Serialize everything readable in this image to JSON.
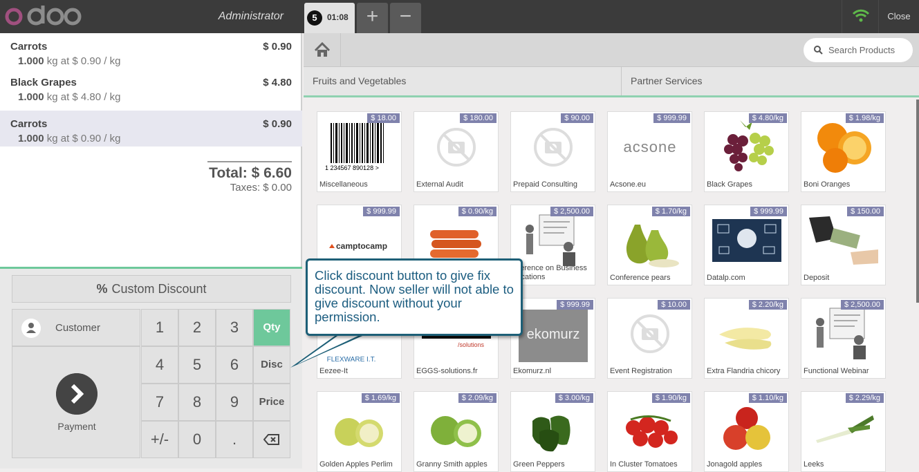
{
  "header": {
    "brand": "odoo",
    "user": "Administrator",
    "order_number": "5",
    "order_time": "01:08",
    "add_order_label": "+",
    "remove_order_label": "−",
    "close_label": "Close"
  },
  "order": {
    "lines": [
      {
        "name": "Carrots",
        "price": "$ 0.90",
        "qty": "1.000",
        "info": "kg at $ 0.90 / kg"
      },
      {
        "name": "Black Grapes",
        "price": "$ 4.80",
        "qty": "1.000",
        "info": "kg at $ 4.80 / kg"
      },
      {
        "name": "Carrots",
        "price": "$ 0.90",
        "qty": "1.000",
        "info": "kg at $ 0.90 / kg"
      }
    ],
    "total": "Total: $ 6.60",
    "taxes": "Taxes: $ 0.00"
  },
  "pad": {
    "custom_discount": "Custom Discount",
    "customer": "Customer",
    "payment": "Payment",
    "keys": [
      "1",
      "2",
      "3",
      "4",
      "5",
      "6",
      "7",
      "8",
      "9",
      "+/-",
      "0",
      "."
    ],
    "qty": "Qty",
    "disc": "Disc",
    "price": "Price"
  },
  "products_header": {
    "search_placeholder": "Search Products",
    "categories": [
      "Fruits and Vegetables",
      "Partner Services"
    ]
  },
  "products": [
    {
      "name": "Miscellaneous",
      "price": "$ 18.00"
    },
    {
      "name": "External Audit",
      "price": "$ 180.00"
    },
    {
      "name": "Prepaid Consulting",
      "price": "$ 90.00"
    },
    {
      "name": "Acsone.eu",
      "price": "$ 999.99"
    },
    {
      "name": "Black Grapes",
      "price": "$ 4.80/kg"
    },
    {
      "name": "Boni Oranges",
      "price": "$ 1.98/kg"
    },
    {
      "name": "",
      "price": "$ 999.99"
    },
    {
      "name": "",
      "price": "$ 0.90/kg"
    },
    {
      "name": "Conference on Business Applications",
      "price": "$ 2,500.00"
    },
    {
      "name": "Conference pears",
      "price": "$ 1.70/kg"
    },
    {
      "name": "Datalp.com",
      "price": "$ 999.99"
    },
    {
      "name": "Deposit",
      "price": "$ 150.00"
    },
    {
      "name": "Eezee-It",
      "price": ""
    },
    {
      "name": "EGGS-solutions.fr",
      "price": ""
    },
    {
      "name": "Ekomurz.nl",
      "price": "$ 999.99"
    },
    {
      "name": "Event Registration",
      "price": "$ 10.00"
    },
    {
      "name": "Extra Flandria chicory",
      "price": "$ 2.20/kg"
    },
    {
      "name": "Functional Webinar",
      "price": "$ 2,500.00"
    },
    {
      "name": "Golden Apples Perlim",
      "price": "$ 1.69/kg"
    },
    {
      "name": "Granny Smith apples",
      "price": "$ 2.09/kg"
    },
    {
      "name": "Green Peppers",
      "price": "$ 3.00/kg"
    },
    {
      "name": "In Cluster Tomatoes",
      "price": "$ 1.90/kg"
    },
    {
      "name": "Jonagold apples",
      "price": "$ 1.10/kg"
    },
    {
      "name": "Leeks",
      "price": "$ 2.29/kg"
    }
  ],
  "logos": {
    "acsone": "acsone",
    "camptocamp": "camptocamp",
    "flexware": "FLEXWARE I.T.",
    "eggs": "/solutions",
    "ekomurz": "ekomurz",
    "barcode_digits": "1 234567 890128 >"
  },
  "callout": {
    "text": "Click discount button to give fix discount. Now seller will not able to give discount without your permission."
  },
  "colors": {
    "topbar": "#3b3b3b",
    "accent_green": "#6ec89b",
    "price_tag": "#7f82ac",
    "callout_border": "#1d5f77",
    "callout_text": "#1c5d80"
  }
}
